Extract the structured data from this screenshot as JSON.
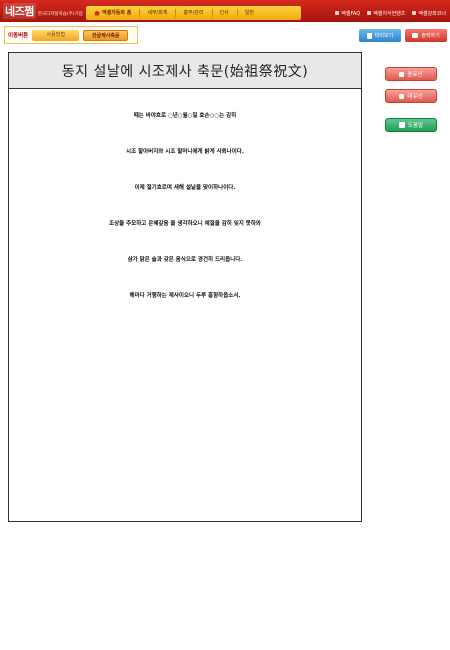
{
  "header": {
    "logo": "네즈쩜",
    "logo_sub": "한국디지털학습(주)기업",
    "nav": [
      {
        "label": "엑셀자동화 홈"
      },
      {
        "label": "세무/회계"
      },
      {
        "label": "총무/관리"
      },
      {
        "label": "인사"
      },
      {
        "label": "일반"
      }
    ],
    "links": [
      {
        "label": "엑셀FAQ"
      },
      {
        "label": "엑셀지식컨텐츠"
      },
      {
        "label": "엑셀강좌코너"
      }
    ]
  },
  "toolbar": {
    "move_label": "이동버튼",
    "usage_label": "사용방법",
    "active_label": "한글제사축문",
    "preview_label": "미리보기",
    "print_label": "출력하기"
  },
  "document": {
    "title": "동지 설날에 시조제사 축문(始祖祭祝文)",
    "lines": [
      "때는 바야흐로 ○년○월○일 효손○○는 감히",
      "시조 할아버지와 시조 할머니에게 밝게 사뢰나이다.",
      "이제 절기흐르며 새해 설날을 맞이하나이다.",
      "조상을 추모하고 은혜갚음 을 생각하오니 예절을 감히 잊지 못하와",
      "삼가 맑은 술과 갖은 음식으로 경건히 드리옵니다.",
      "해마다 거행하는 제사이오니 두루 흠향하옵소서."
    ]
  },
  "side": {
    "jongyu_label": "종유선",
    "daeyu_label": "대유선",
    "help_label": "도움말"
  },
  "colors": {
    "topbar": "#b81c12",
    "nav": "#f8c030",
    "preview": "#3a8ed0",
    "print": "#d8453a",
    "help": "#28a858"
  }
}
